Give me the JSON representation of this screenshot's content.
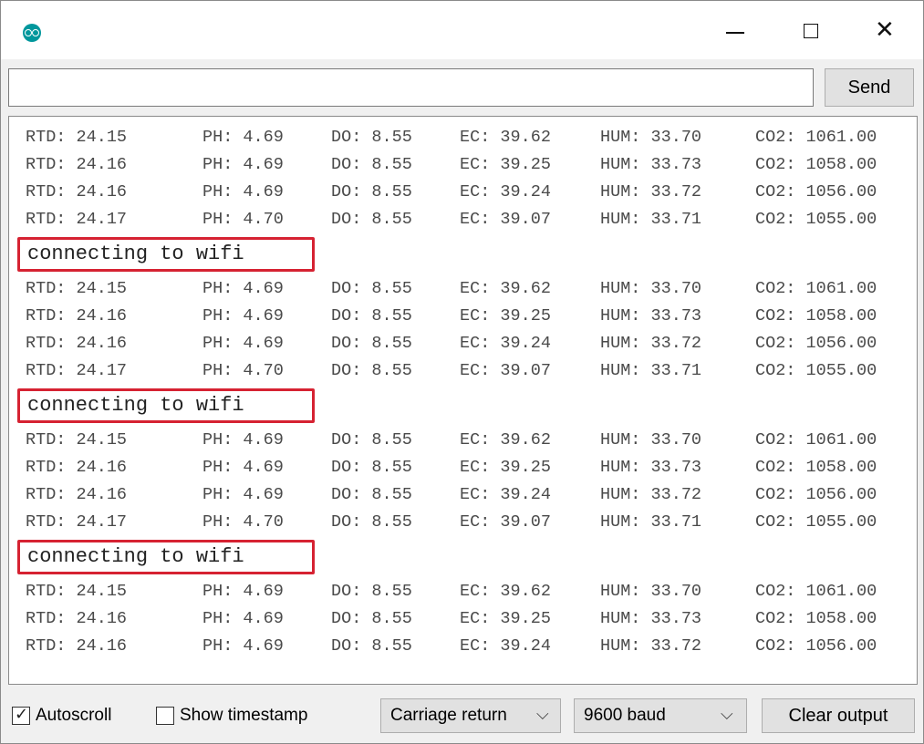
{
  "window": {
    "app_icon": "arduino-icon",
    "controls": {
      "minimize": "minimize-icon",
      "maximize": "maximize-icon",
      "close": "close-icon"
    }
  },
  "send_bar": {
    "input_value": "",
    "send_label": "Send"
  },
  "serial_output": {
    "blocks": [
      {
        "lines": [
          [
            "RTD: 24.15",
            "PH: 4.69",
            "DO: 8.55",
            "EC: 39.62",
            "HUM: 33.70",
            "CO2: 1061.00"
          ],
          [
            "RTD: 24.16",
            "PH: 4.69",
            "DO: 8.55",
            "EC: 39.25",
            "HUM: 33.73",
            "CO2: 1058.00"
          ],
          [
            "RTD: 24.16",
            "PH: 4.69",
            "DO: 8.55",
            "EC: 39.24",
            "HUM: 33.72",
            "CO2: 1056.00"
          ],
          [
            "RTD: 24.17",
            "PH: 4.70",
            "DO: 8.55",
            "EC: 39.07",
            "HUM: 33.71",
            "CO2: 1055.00"
          ]
        ],
        "message": "connecting to wifi"
      },
      {
        "lines": [
          [
            "RTD: 24.15",
            "PH: 4.69",
            "DO: 8.55",
            "EC: 39.62",
            "HUM: 33.70",
            "CO2: 1061.00"
          ],
          [
            "RTD: 24.16",
            "PH: 4.69",
            "DO: 8.55",
            "EC: 39.25",
            "HUM: 33.73",
            "CO2: 1058.00"
          ],
          [
            "RTD: 24.16",
            "PH: 4.69",
            "DO: 8.55",
            "EC: 39.24",
            "HUM: 33.72",
            "CO2: 1056.00"
          ],
          [
            "RTD: 24.17",
            "PH: 4.70",
            "DO: 8.55",
            "EC: 39.07",
            "HUM: 33.71",
            "CO2: 1055.00"
          ]
        ],
        "message": "connecting to wifi"
      },
      {
        "lines": [
          [
            "RTD: 24.15",
            "PH: 4.69",
            "DO: 8.55",
            "EC: 39.62",
            "HUM: 33.70",
            "CO2: 1061.00"
          ],
          [
            "RTD: 24.16",
            "PH: 4.69",
            "DO: 8.55",
            "EC: 39.25",
            "HUM: 33.73",
            "CO2: 1058.00"
          ],
          [
            "RTD: 24.16",
            "PH: 4.69",
            "DO: 8.55",
            "EC: 39.24",
            "HUM: 33.72",
            "CO2: 1056.00"
          ],
          [
            "RTD: 24.17",
            "PH: 4.70",
            "DO: 8.55",
            "EC: 39.07",
            "HUM: 33.71",
            "CO2: 1055.00"
          ]
        ],
        "message": "connecting to wifi"
      },
      {
        "lines": [
          [
            "RTD: 24.15",
            "PH: 4.69",
            "DO: 8.55",
            "EC: 39.62",
            "HUM: 33.70",
            "CO2: 1061.00"
          ],
          [
            "RTD: 24.16",
            "PH: 4.69",
            "DO: 8.55",
            "EC: 39.25",
            "HUM: 33.73",
            "CO2: 1058.00"
          ],
          [
            "RTD: 24.16",
            "PH: 4.69",
            "DO: 8.55",
            "EC: 39.24",
            "HUM: 33.72",
            "CO2: 1056.00"
          ]
        ],
        "message": ""
      }
    ],
    "highlight_color": "#d62232"
  },
  "bottom_bar": {
    "autoscroll": {
      "label": "Autoscroll",
      "checked": true
    },
    "show_timestamp": {
      "label": "Show timestamp",
      "checked": false
    },
    "line_ending": {
      "selected": "Carriage return"
    },
    "baud_rate": {
      "selected": "9600 baud"
    },
    "clear_label": "Clear output"
  }
}
